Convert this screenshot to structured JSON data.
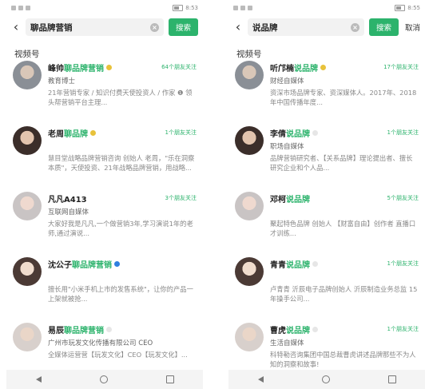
{
  "left": {
    "status_time": "8:53",
    "query": "聊品牌营销",
    "search_label": "搜索",
    "section": "视频号",
    "items": [
      {
        "name_plain": "峰帅",
        "name_hl": "聊品牌营销",
        "badge": "gold",
        "follow": "64个朋友关注",
        "tag": "教育博士",
        "desc": "21年营销专家 / 知识付费天使投资人 / 作家 ❶ 领头帮营销平台主理..."
      },
      {
        "name_plain": "老周",
        "name_hl": "聊品牌",
        "badge": "gold",
        "follow": "1个朋友关注",
        "tag": "",
        "desc": "慧目堂战略品牌营销咨询 创始人 老周，\"乐在洞察本质\"，天使投资、21年战略品牌营销，用战略..."
      },
      {
        "name_plain": "凡凡A413",
        "name_hl": "",
        "badge": "",
        "follow": "3个朋友关注",
        "tag": "互联网自媒体",
        "desc": "大家好我是凡凡,一个做营销3年,学习演说1年的老师,通过演说..."
      },
      {
        "name_plain": "沈公子",
        "name_hl": "聊品牌营销",
        "badge": "blue",
        "follow": "",
        "tag": "",
        "desc": "擅长用\"小米手机上市的发售系统\"，让你的产品一上架就被抢..."
      },
      {
        "name_plain": "易辰",
        "name_hl": "聊品牌营销",
        "badge": "grey",
        "follow": "",
        "tag": "广州市玩发文化传播有限公司 CEO",
        "desc": "全媒体运营营【玩发文化】CEO【玩发文化】..."
      }
    ]
  },
  "right": {
    "status_time": "8:55",
    "query": "说品牌",
    "search_label": "搜索",
    "cancel_label": "取消",
    "section": "视频号",
    "items": [
      {
        "name_plain": "听邝楠",
        "name_hl": "说品牌",
        "badge": "gold",
        "follow": "17个朋友关注",
        "tag": "财经自媒体",
        "desc": "资深市场品牌专家、资深媒体人。2017年、2018年中国传播年度..."
      },
      {
        "name_plain": "李倩",
        "name_hl": "说品牌",
        "badge": "grey",
        "follow": "1个朋友关注",
        "tag": "职场自媒体",
        "desc": "品牌营销研究者、【关系品牌】理论提出者、擅长研究企业和个人品..."
      },
      {
        "name_plain": "邓柯",
        "name_hl": "说品牌",
        "badge": "",
        "follow": "5个朋友关注",
        "tag": "",
        "desc": "聚起特色品牌 创始人 【财富自由】创作者 直播口才训练..."
      },
      {
        "name_plain": "青青",
        "name_hl": "说品牌",
        "badge": "grey",
        "follow": "1个朋友关注",
        "tag": "",
        "desc": "卢青青 沂辰电子品牌创始人 沂辰制造业务总监 15年操手公司..."
      },
      {
        "name_plain": "曹虎",
        "name_hl": "说品牌",
        "badge": "grey",
        "follow": "1个朋友关注",
        "tag": "生活自媒体",
        "desc": "科特勒咨询集团中国总裁曹虎讲述品牌那些不为人知的洞察和故事!"
      }
    ]
  },
  "colors": {
    "accent": "#2cb36c",
    "gold_badge": "#e8c23b",
    "blue_badge": "#2f7fe0"
  },
  "icons": [
    "back-arrow-icon",
    "clear-icon",
    "nav-back-icon",
    "nav-home-icon",
    "nav-recents-icon"
  ]
}
